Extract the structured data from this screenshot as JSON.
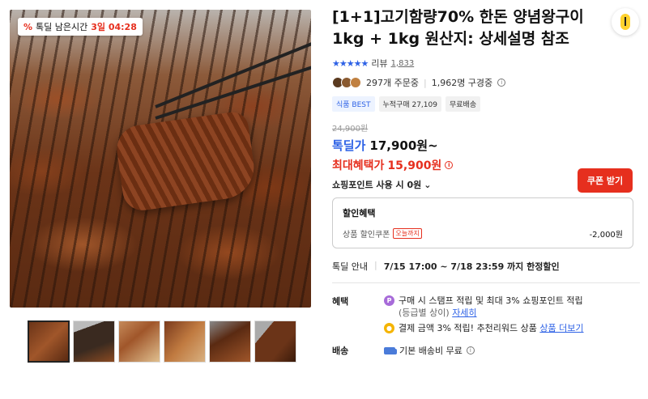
{
  "image": {
    "timer_label": "톡딜 남은시간",
    "timer_icon": "%",
    "timer_value": "3일 04:28",
    "thumbnail_count": 6
  },
  "product": {
    "title": "[1+1]고기함량70% 한돈 양념왕구이 1kg + 1kg 원산지: 상세설명 참조",
    "stars": "★★★★★",
    "review_label": "리뷰",
    "review_count": "1,833",
    "order_count": "297개 주문중",
    "subscriber_count": "1,962명 구경중",
    "tags": [
      "식품 BEST",
      "누적구매 27,109",
      "무료배송"
    ],
    "original_price": "24,900원",
    "price_label": "톡딜가",
    "price_value": "17,900원~",
    "max_benefit_label": "최대혜택가",
    "max_benefit_value": "15,900원",
    "coupon_button": "쿠폰 받기",
    "point_row": "쇼핑포인트 사용 시 0원",
    "discount_box": {
      "header": "할인혜택",
      "label": "상품 할인쿠폰",
      "badge": "오늘까지",
      "amount": "-2,000원"
    },
    "notice_label": "톡딜 안내",
    "notice_value": "7/15 17:00 ~ 7/18 23:59 까지 한정할인",
    "benefit_label": "혜택",
    "benefit_line1": "구매 시 스탬프 적립 및 최대 3% 쇼핑포인트 적립",
    "benefit_line1b": "(등급별 상이)",
    "benefit_line1_link": "자세히",
    "benefit_line2": "결제 금액 3% 적립! 추천리워드 상품",
    "benefit_line2_link": "상품 더보기",
    "shipping_label": "배송",
    "shipping_value": "기본 배송비 무료"
  }
}
